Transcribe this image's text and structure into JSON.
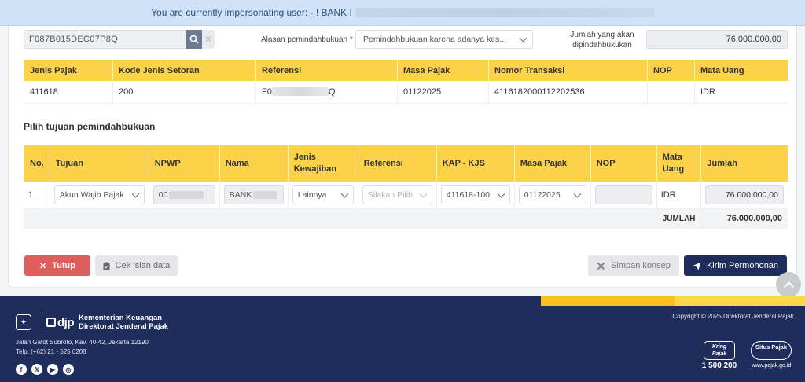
{
  "banner": {
    "text": "You are currently impersonating user: - ! BANK I"
  },
  "form": {
    "referensi_value": "F087B015DEC07P8Q",
    "alasan_label": "Alasan pemindahbukuan",
    "alasan_required_mark": "*",
    "alasan_value": "Pemindahbukuan karena adanya kes...",
    "jumlah_label": "Jumlah yang akan dipindahbukukan",
    "jumlah_value": "76.000.000,00"
  },
  "source_table": {
    "headers": [
      "Jenis Pajak",
      "Kode Jenis Setoran",
      "Referensi",
      "Masa Pajak",
      "Nomor Transaksi",
      "NOP",
      "Mata Uang"
    ],
    "row": {
      "jenis_pajak": "411618",
      "kode_jenis_setoran": "200",
      "referensi_prefix": "F0",
      "referensi_suffix": "Q",
      "masa_pajak": "01122025",
      "nomor_transaksi": "4116182000112202536",
      "nop": "",
      "mata_uang": "IDR"
    }
  },
  "section_title": "Pilih tujuan pemindahbukuan",
  "dest_table": {
    "headers": [
      "No.",
      "Tujuan",
      "NPWP",
      "Nama",
      "Jenis Kewajiban",
      "Referensi",
      "KAP - KJS",
      "Masa Pajak",
      "NOP",
      "Mata Uang",
      "Jumlah"
    ],
    "row": {
      "no": "1",
      "tujuan": "Akun Wajib Pajak",
      "npwp": "00",
      "nama": "BANK",
      "jenis_kewajiban": "Lainnya",
      "referensi_placeholder": "Silakan Pilih",
      "kap_kjs": "411618-100",
      "masa_pajak": "01122025",
      "nop": "",
      "mata_uang": "IDR",
      "jumlah": "76.000.000,00"
    },
    "total_label": "JUMLAH",
    "total_value": "76.000.000,00"
  },
  "buttons": {
    "tutup": "Tutup",
    "cek": "Cek isian data",
    "simpan": "Simpan konsep",
    "kirim": "Kirim Permohonan"
  },
  "footer": {
    "org_line1": "Kementerian Keuangan",
    "org_line2": "Direktorat Jenderal Pajak",
    "djp": "djp",
    "address": "Jalan Gatot Subroto, Kav. 40-42, Jakarta 12190",
    "phone": "Telp: (+62) 21 - 525 0208",
    "copyright": "Copyright © 2025 Direktorat Jenderal Pajak.",
    "kring_logo": "Kring Pajak",
    "kring_number": "1 500 200",
    "situs_logo": "Situs Pajak",
    "situs_url": "www.pajak.go.id",
    "socials": [
      "facebook-icon",
      "x-icon",
      "youtube-icon",
      "instagram-icon"
    ]
  },
  "colors": {
    "table_header": "#fcd24a",
    "primary": "#1f2d5c",
    "danger": "#de5d5d",
    "banner_bg": "#cfe2f7",
    "stripe_yellow": "#f6c21b"
  }
}
